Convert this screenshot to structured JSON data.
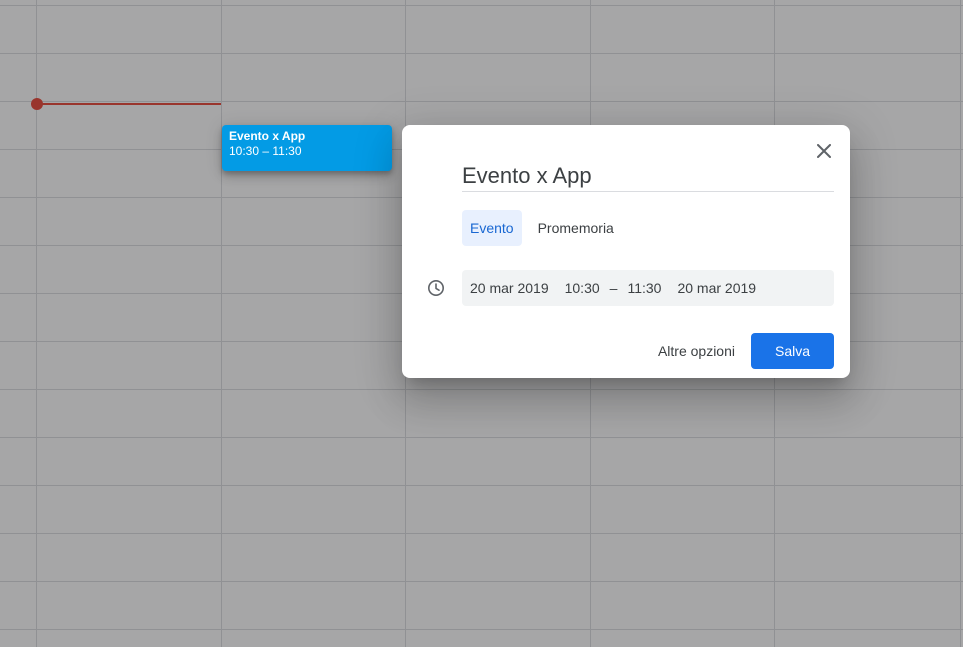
{
  "calendar": {
    "event_chip": {
      "title": "Evento x App",
      "time": "10:30 – 11:30",
      "color": "#039be5"
    },
    "now_indicator_color": "#ea4335"
  },
  "dialog": {
    "close_icon": "close-icon",
    "title_value": "Evento x App",
    "tabs": [
      {
        "label": "Evento",
        "selected": true
      },
      {
        "label": "Promemoria",
        "selected": false
      }
    ],
    "time_icon": "clock-icon",
    "datetime": {
      "start_date": "20 mar 2019",
      "start_time": "10:30",
      "separator": "–",
      "end_time": "11:30",
      "end_date": "20 mar 2019"
    },
    "actions": {
      "more_options_label": "Altre opzioni",
      "save_label": "Salva"
    },
    "accent_color": "#1a73e8",
    "selected_tab_bg": "#e8f0fe"
  }
}
